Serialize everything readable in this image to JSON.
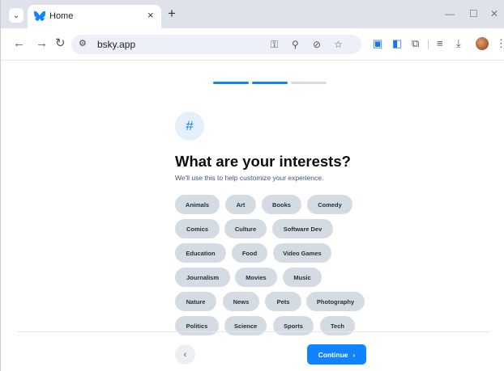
{
  "browser": {
    "tab_title": "Home",
    "tab_close": "×",
    "new_tab": "+",
    "url": "bsky.app",
    "minimize": "—",
    "maximize": "☐",
    "close": "✕",
    "icons": [
      "tab-search-icon",
      "bluesky-favicon-icon",
      "back-icon",
      "forward-icon",
      "reload-icon",
      "site-info-icon",
      "password-key-icon",
      "zoom-icon",
      "eye-off-icon",
      "bookmark-star-icon",
      "extension-translate-icon",
      "extension-icon",
      "puzzle-extensions-icon",
      "reading-list-icon",
      "download-icon",
      "profile-avatar",
      "menu-dots-icon"
    ]
  },
  "onboarding": {
    "steps": [
      {
        "state": "done"
      },
      {
        "state": "done"
      },
      {
        "state": "pending"
      }
    ],
    "colors": {
      "accent": "#1083fe",
      "pending": "#d5dbe2"
    },
    "hash_symbol": "#",
    "title": "What are your interests?",
    "subtitle": "We'll use this to help customize your experience.",
    "interests": [
      "Animals",
      "Art",
      "Books",
      "Comedy",
      "Comics",
      "Culture",
      "Software Dev",
      "Education",
      "Food",
      "Video Games",
      "Journalism",
      "Movies",
      "Music",
      "Nature",
      "News",
      "Pets",
      "Photography",
      "Politics",
      "Science",
      "Sports",
      "Tech"
    ],
    "back_label": "‹",
    "continue_label": "Continue",
    "continue_chevron": "›"
  }
}
